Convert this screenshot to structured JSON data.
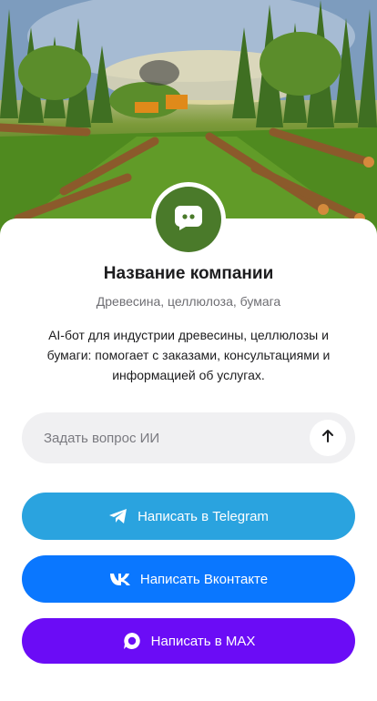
{
  "hero": {
    "image": "forest-logging-scene"
  },
  "company": {
    "avatar_icon": "chat-bubble-icon",
    "name": "Название компании",
    "subtitle": "Древесина, целлюлоза, бумага",
    "description": "AI-бот для индустрии древесины, целлюлозы и бумаги: помогает с заказами, консультациями и информацией об услугах."
  },
  "ask": {
    "placeholder": "Задать вопрос ИИ",
    "value": "",
    "send_icon": "arrow-up-icon"
  },
  "actions": {
    "telegram": {
      "label": "Написать в Telegram",
      "icon": "telegram-icon",
      "color": "#2aa3df"
    },
    "vk": {
      "label": "Написать Вконтакте",
      "icon": "vk-icon",
      "color": "#0a77ff"
    },
    "max": {
      "label": "Написать в MAX",
      "icon": "max-icon",
      "color": "#6b0cf6"
    }
  },
  "colors": {
    "avatar_bg": "#4a7a2a",
    "ask_bg": "#f0f0f2"
  }
}
